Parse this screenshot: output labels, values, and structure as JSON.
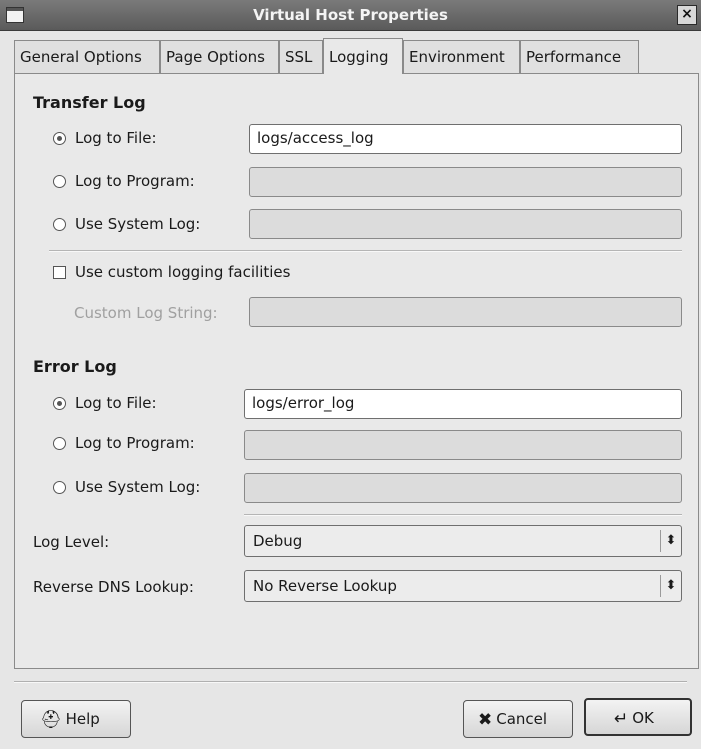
{
  "window": {
    "title": "Virtual Host Properties",
    "close_glyph": "×"
  },
  "tabs": [
    {
      "label": "General Options"
    },
    {
      "label": "Page Options"
    },
    {
      "label": "SSL"
    },
    {
      "label": "Logging"
    },
    {
      "label": "Environment"
    },
    {
      "label": "Performance"
    }
  ],
  "active_tab": "Logging",
  "transfer_log": {
    "title": "Transfer Log",
    "log_to_file": {
      "label": "Log to File:",
      "value": "logs/access_log",
      "checked": true
    },
    "log_to_program": {
      "label": "Log to Program:",
      "value": ""
    },
    "use_system_log": {
      "label": "Use System Log:",
      "value": ""
    },
    "custom_logging": {
      "label": "Use custom logging facilities",
      "checked": false
    },
    "custom_log_string": {
      "label": "Custom Log String:",
      "value": ""
    }
  },
  "error_log": {
    "title": "Error Log",
    "log_to_file": {
      "label": "Log to File:",
      "value": "logs/error_log",
      "checked": true
    },
    "log_to_program": {
      "label": "Log to Program:",
      "value": ""
    },
    "use_system_log": {
      "label": "Use System Log:",
      "value": ""
    }
  },
  "log_level": {
    "label": "Log Level:",
    "value": "Debug"
  },
  "reverse_dns": {
    "label": "Reverse DNS Lookup:",
    "value": "No Reverse Lookup"
  },
  "buttons": {
    "help": "Help",
    "cancel": "Cancel",
    "ok": "OK"
  },
  "icons": {
    "help": "help-icon",
    "cancel": "cancel-x-icon",
    "ok": "ok-arrow-icon",
    "combo": "updown-arrow-icon"
  }
}
